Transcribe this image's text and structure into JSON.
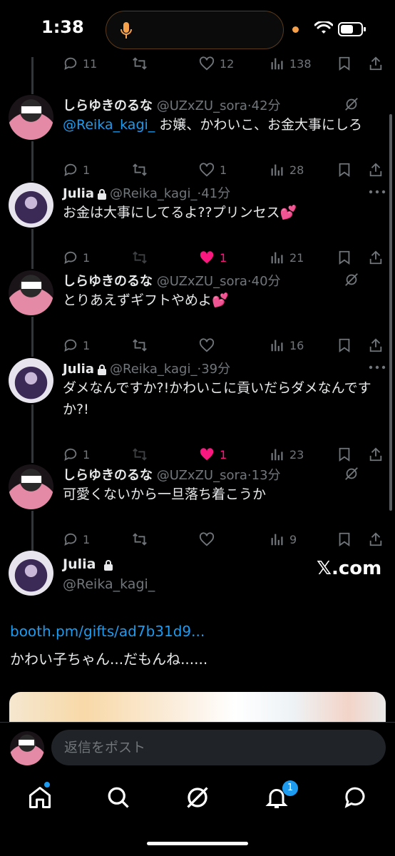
{
  "status_bar": {
    "time": "1:38",
    "icons": [
      "mic-icon",
      "wifi-icon",
      "battery-icon"
    ]
  },
  "top_partial_actions": {
    "reply_count": "11",
    "like_count": "12",
    "views": "138"
  },
  "tweets": [
    {
      "name": "しらゆきのるな",
      "handle": "@UZxZU_sora",
      "time": "42分",
      "mention": "@Reika_kagi_",
      "text": " お嬢、かわいこ、お金大事にしろ",
      "reply_count": "1",
      "like_count": "1",
      "views": "28",
      "liked": false
    },
    {
      "name": "Julia",
      "handle": "@Reika_kagi_",
      "time": "41分",
      "text": "お金は大事にしてるよ??プリンセス💕",
      "reply_count": "1",
      "like_count": "1",
      "views": "21",
      "liked": true
    },
    {
      "name": "しらゆきのるな",
      "handle": "@UZxZU_sora",
      "time": "40分",
      "text": "とりあえずギフトやめよ💕",
      "reply_count": "1",
      "like_count": "",
      "views": "16",
      "liked": false
    },
    {
      "name": "Julia",
      "handle": "@Reika_kagi_",
      "time": "39分",
      "text": "ダメなんですか?!かわいこに貢いだらダメなんですか?!",
      "reply_count": "1",
      "like_count": "1",
      "views": "23",
      "liked": true
    },
    {
      "name": "しらゆきのるな",
      "handle": "@UZxZU_sora",
      "time": "13分",
      "text": "可愛くないから一旦落ち着こうか",
      "reply_count": "1",
      "like_count": "",
      "views": "9",
      "liked": false
    }
  ],
  "focused_tweet": {
    "name": "Julia",
    "handle": "@Reika_kagi_",
    "link": "booth.pm/gifts/ad7b31d9...",
    "text": "かわい子ちゃん...だもんね......",
    "source_badge": "𝕏.com"
  },
  "reply_bar": {
    "placeholder": "返信をポスト"
  },
  "bottom_nav": {
    "items": [
      "home-icon",
      "search-icon",
      "grok-icon",
      "notifications-icon",
      "messages-icon"
    ],
    "notification_badge": "1"
  },
  "colors": {
    "accent": "#1d9bf0",
    "like": "#f91880",
    "muted": "#71767b",
    "background": "#000000"
  }
}
